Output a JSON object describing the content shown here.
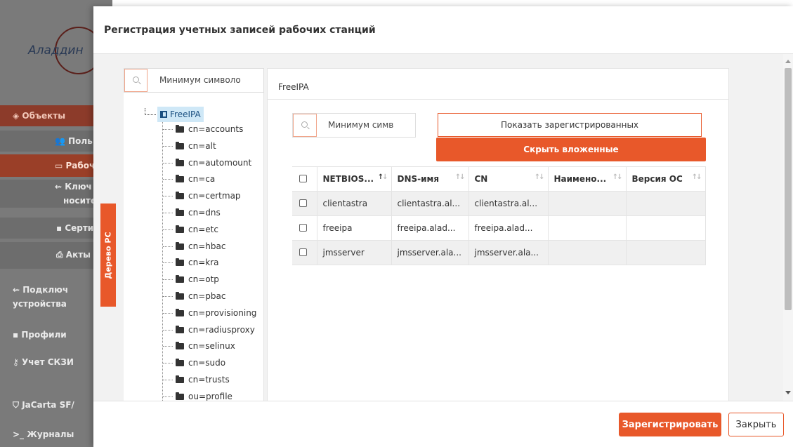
{
  "background": {
    "logo_text": "Аладдин",
    "nav": [
      {
        "label": "Объекты",
        "icon": "diamond-icon"
      },
      {
        "label": "Поль",
        "icon": "users-icon"
      },
      {
        "label": "Рабоч",
        "icon": "monitor-icon"
      },
      {
        "label": "Ключ",
        "icon": "usb-icon"
      },
      {
        "label": "носител",
        "icon": ""
      },
      {
        "label": "Серти",
        "icon": "file-icon"
      },
      {
        "label": "Акты",
        "icon": "print-icon"
      },
      {
        "label": "Подключ",
        "icon": "usb-icon"
      },
      {
        "label": "устройства",
        "icon": ""
      },
      {
        "label": "Профили",
        "icon": "folder-icon"
      },
      {
        "label": "Учет СКЗИ",
        "icon": "key-icon"
      },
      {
        "label": "JaCarta SF/",
        "icon": "shield-icon"
      },
      {
        "label": "Журналы",
        "icon": "terminal-icon"
      }
    ]
  },
  "modal": {
    "title": "Регистрация учетных записей рабочих станций",
    "tree_tab_label": "Дерево РС",
    "tree": {
      "search_placeholder": "Минимум символо",
      "root": "FreeIPA",
      "items": [
        "cn=accounts",
        "cn=alt",
        "cn=automount",
        "cn=ca",
        "cn=certmap",
        "cn=dns",
        "cn=etc",
        "cn=hbac",
        "cn=kra",
        "cn=otp",
        "cn=pbac",
        "cn=provisioning",
        "cn=radiusproxy",
        "cn=selinux",
        "cn=sudo",
        "cn=trusts",
        "ou=profile"
      ]
    },
    "main": {
      "header": "FreeIPA",
      "search_placeholder": "Минимум симв",
      "show_registered_label": "Показать зарегистрированных",
      "hide_nested_label": "Скрыть вложенные",
      "columns": [
        "NETBIOS...",
        "DNS-имя",
        "CN",
        "Наимено...",
        "Версия ОС"
      ],
      "rows": [
        {
          "netbios": "clientastra",
          "dns": "clientastra.al...",
          "cn": "clientastra.al...",
          "name": "",
          "os": ""
        },
        {
          "netbios": "freeipa",
          "dns": "freeipa.alad...",
          "cn": "freeipa.alad...",
          "name": "",
          "os": ""
        },
        {
          "netbios": "jmsserver",
          "dns": "jmsserver.ala...",
          "cn": "jmsserver.ala...",
          "name": "",
          "os": ""
        }
      ]
    },
    "register_label": "Зарегистрировать",
    "close_label": "Закрыть"
  },
  "colors": {
    "accent": "#e8582a",
    "tree_selected": "#cfe8f7"
  }
}
